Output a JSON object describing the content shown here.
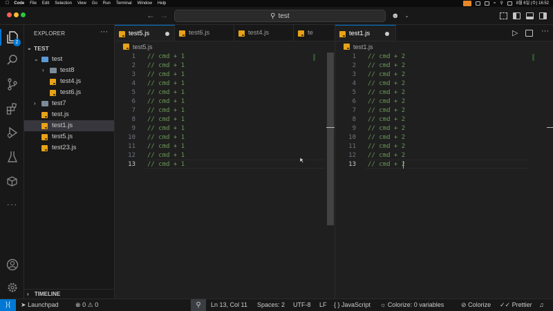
{
  "menubar": {
    "app": "Code",
    "items": [
      "File",
      "Edit",
      "Selection",
      "View",
      "Go",
      "Run",
      "Terminal",
      "Window",
      "Help"
    ],
    "clock": "8월 6일 (수) 16:52"
  },
  "titlebar": {
    "search_text": "test",
    "back_icon": "arrow-left-icon",
    "forward_icon": "arrow-right-icon"
  },
  "activity": {
    "explorer_badge": "2"
  },
  "sidebar": {
    "header": "EXPLORER",
    "root": "TEST",
    "tree": [
      {
        "label": "test",
        "kind": "folder-open",
        "indent": 1
      },
      {
        "label": "test8",
        "kind": "folder",
        "indent": 2
      },
      {
        "label": "test4.js",
        "kind": "js",
        "indent": 2
      },
      {
        "label": "test6.js",
        "kind": "js",
        "indent": 2
      },
      {
        "label": "test7",
        "kind": "folder",
        "indent": 1
      },
      {
        "label": "test.js",
        "kind": "js",
        "indent": 1
      },
      {
        "label": "test1.js",
        "kind": "js",
        "indent": 1,
        "selected": true
      },
      {
        "label": "test5.js",
        "kind": "js",
        "indent": 1
      },
      {
        "label": "test23.js",
        "kind": "js",
        "indent": 1
      }
    ],
    "timeline": "TIMELINE"
  },
  "left_group": {
    "tabs": [
      "test5.js",
      "test6.js",
      "test4.js",
      "te"
    ],
    "breadcrumb": "test5.js",
    "lines": [
      "// cmd + 1",
      "// cmd + 1",
      "// cmd + 1",
      "// cmd + 1",
      "// cmd + 1",
      "// cmd + 1",
      "// cmd + 1",
      "// cmd + 1",
      "// cmd + 1",
      "// cmd + 1",
      "// cmd + 1",
      "// cmd + 1",
      "// cmd + 1"
    ],
    "line_numbers": [
      "1",
      "2",
      "3",
      "4",
      "5",
      "6",
      "7",
      "8",
      "9",
      "10",
      "11",
      "12",
      "13"
    ]
  },
  "right_group": {
    "tabs": [
      "test1.js"
    ],
    "breadcrumb": "test1.js",
    "lines": [
      "// cmd + 2",
      "// cmd + 2",
      "// cmd + 2",
      "// cmd + 2",
      "// cmd + 2",
      "// cmd + 2",
      "// cmd + 2",
      "// cmd + 2",
      "// cmd + 2",
      "// cmd + 2",
      "// cmd + 2",
      "// cmd + 2",
      "// cmd + 2"
    ],
    "line_numbers": [
      "1",
      "2",
      "3",
      "4",
      "5",
      "6",
      "7",
      "8",
      "9",
      "10",
      "11",
      "12",
      "13"
    ]
  },
  "status": {
    "launchpad": "Launchpad",
    "errors": "0",
    "warnings": "0",
    "position": "Ln 13, Col 11",
    "spaces": "Spaces: 2",
    "encoding": "UTF-8",
    "eol": "LF",
    "language": "JavaScript",
    "colorize_vars": "Colorize: 0 variables",
    "colorize": "Colorize",
    "prettier": "Prettier"
  }
}
